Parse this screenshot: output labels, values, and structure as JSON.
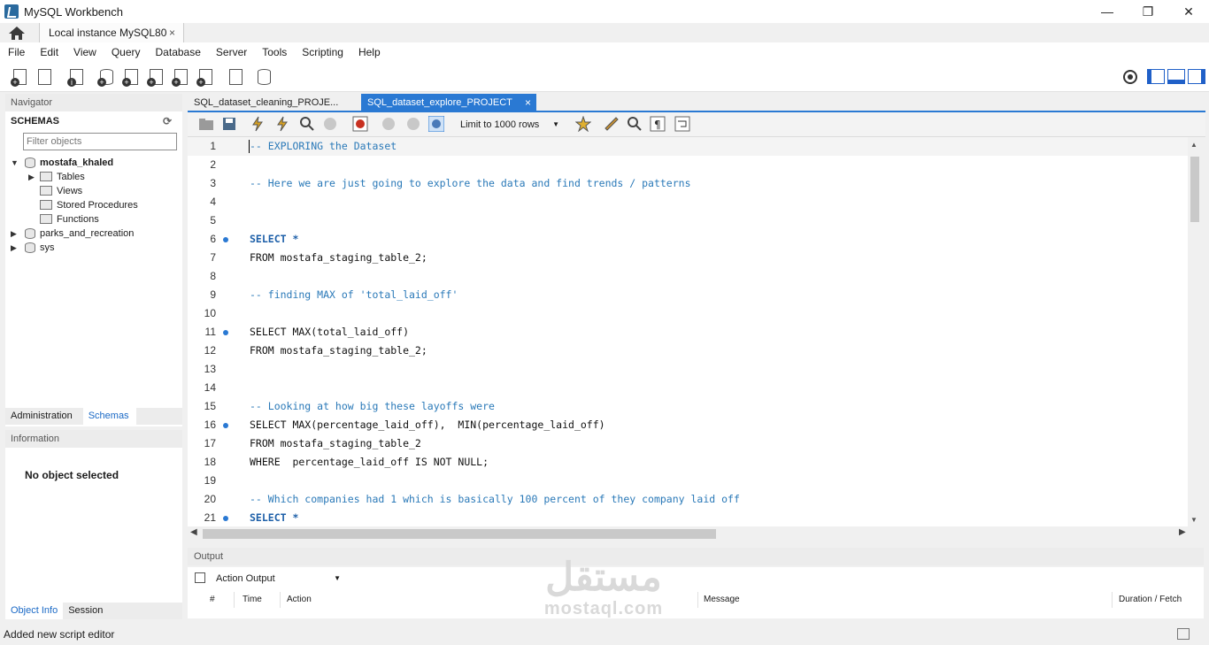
{
  "window": {
    "title": "MySQL Workbench",
    "controls": {
      "minimize": "—",
      "maximize": "❐",
      "close": "✕"
    }
  },
  "connection_tab": {
    "label": "Local instance MySQL80",
    "close": "×"
  },
  "menu": [
    "File",
    "Edit",
    "View",
    "Query",
    "Database",
    "Server",
    "Tools",
    "Scripting",
    "Help"
  ],
  "navigator": {
    "header": "Navigator",
    "schemas_label": "SCHEMAS",
    "filter_placeholder": "Filter objects",
    "tree": [
      {
        "label": "mostafa_khaled",
        "expanded": true,
        "bold": true
      },
      {
        "label": "Tables"
      },
      {
        "label": "Views"
      },
      {
        "label": "Stored Procedures"
      },
      {
        "label": "Functions"
      },
      {
        "label": "parks_and_recreation"
      },
      {
        "label": "sys"
      }
    ],
    "tabs": [
      "Administration",
      "Schemas"
    ]
  },
  "information": {
    "header": "Information",
    "empty_text": "No object selected",
    "tabs": [
      "Object Info",
      "Session"
    ]
  },
  "editor": {
    "tabs": [
      {
        "label": "SQL_dataset_cleaning_PROJE...",
        "active": false
      },
      {
        "label": "SQL_dataset_explore_PROJECT",
        "active": true,
        "close": "×"
      }
    ],
    "limit_rows": "Limit to 1000 rows",
    "lines": [
      {
        "n": "1",
        "text": "-- EXPLORING the Dataset"
      },
      {
        "n": "2",
        "text": ""
      },
      {
        "n": "3",
        "text": "-- Here we are just going to explore the data and find trends / patterns"
      },
      {
        "n": "4",
        "text": ""
      },
      {
        "n": "5",
        "text": ""
      },
      {
        "n": "6",
        "text": "SELECT *"
      },
      {
        "n": "7",
        "text": "FROM mostafa_staging_table_2;"
      },
      {
        "n": "8",
        "text": ""
      },
      {
        "n": "9",
        "text": "-- finding MAX of 'total_laid_off'"
      },
      {
        "n": "10",
        "text": ""
      },
      {
        "n": "11",
        "text": "SELECT MAX(total_laid_off)"
      },
      {
        "n": "12",
        "text": "FROM mostafa_staging_table_2;"
      },
      {
        "n": "13",
        "text": ""
      },
      {
        "n": "14",
        "text": ""
      },
      {
        "n": "15",
        "text": "-- Looking at how big these layoffs were"
      },
      {
        "n": "16",
        "text": "SELECT MAX(percentage_laid_off),  MIN(percentage_laid_off)"
      },
      {
        "n": "17",
        "text": "FROM mostafa_staging_table_2"
      },
      {
        "n": "18",
        "text": "WHERE  percentage_laid_off IS NOT NULL;"
      },
      {
        "n": "19",
        "text": ""
      },
      {
        "n": "20",
        "text": "-- Which companies had 1 which is basically 100 percent of they company laid off"
      },
      {
        "n": "21",
        "text": "SELECT *"
      }
    ]
  },
  "output": {
    "header": "Output",
    "selector": "Action Output",
    "columns": [
      "#",
      "Time",
      "Action",
      "Message",
      "Duration / Fetch"
    ]
  },
  "status": {
    "text": "Added new script editor"
  },
  "watermark": {
    "arabic": "مستقل",
    "latin": "mostaql.com"
  }
}
